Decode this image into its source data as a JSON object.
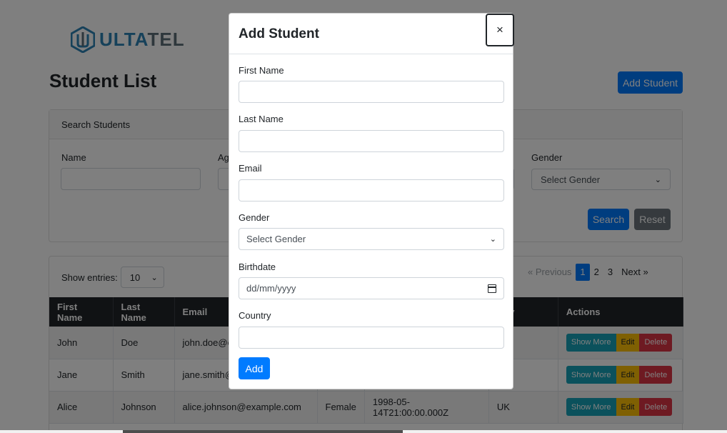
{
  "brand": {
    "logo_text_a": "ULTA",
    "logo_text_b": "TEL"
  },
  "page": {
    "title": "Student List",
    "add_student_label": "Add Student"
  },
  "search": {
    "header": "Search Students",
    "name_label": "Name",
    "age_label": "Ag",
    "gender_label": "Gender",
    "gender_select": "Select Gender",
    "search_label": "Search",
    "reset_label": "Reset"
  },
  "table": {
    "show_entries_label": "Show entries:",
    "entries_value": "10",
    "pagination": {
      "previous": "Previous",
      "pages": [
        "1",
        "2",
        "3"
      ],
      "next": "Next",
      "active_page": "1"
    },
    "columns": [
      "First Name",
      "Last Name",
      "Email",
      "",
      "",
      "ntry",
      "Actions"
    ],
    "rows": [
      {
        "first": "John",
        "last": "Doe",
        "email": "john.doe@e",
        "gender": "",
        "birth": "",
        "country": ""
      },
      {
        "first": "Jane",
        "last": "Smith",
        "email": "jane.smith@",
        "gender": "",
        "birth": "",
        "country": "ada"
      },
      {
        "first": "Alice",
        "last": "Johnson",
        "email": "alice.johnson@example.com",
        "gender": "Female",
        "birth": "1998-05-14T21:00:00.000Z",
        "country": "UK"
      }
    ],
    "actions": {
      "show_more": "Show More",
      "edit": "Edit",
      "delete": "Delete"
    }
  },
  "modal": {
    "title": "Add Student",
    "close_glyph": "×",
    "first_name_label": "First Name",
    "last_name_label": "Last Name",
    "email_label": "Email",
    "gender_label": "Gender",
    "gender_select": "Select Gender",
    "birthdate_label": "Birthdate",
    "birthdate_placeholder": "dd/mm/yyyy",
    "country_label": "Country",
    "add_label": "Add"
  }
}
